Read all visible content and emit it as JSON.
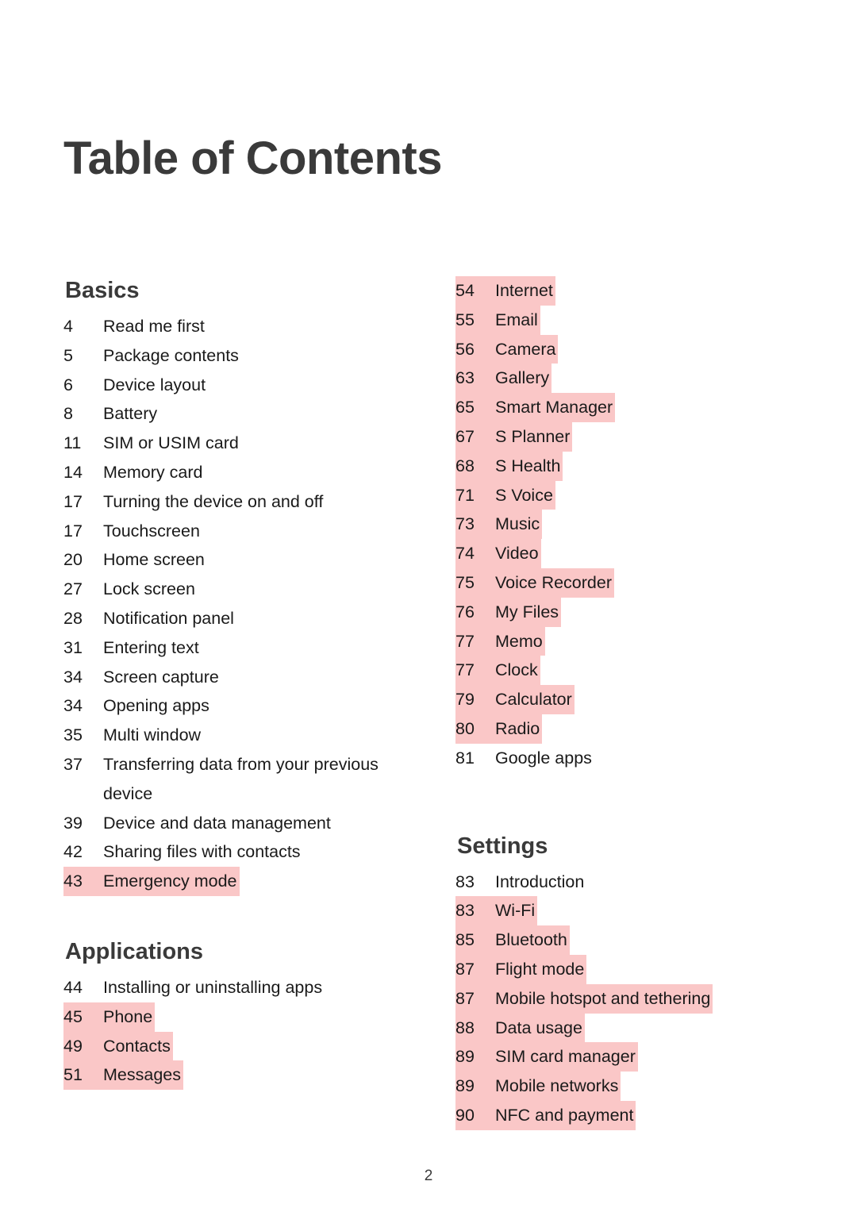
{
  "document": {
    "title": "Table of Contents",
    "page_number": "2",
    "highlight_color": "#fac7c7",
    "text_color": "#1a1a1a",
    "heading_color": "#3a3a3a",
    "background_color": "#ffffff"
  },
  "columns": {
    "left": {
      "sections": [
        {
          "heading": "Basics",
          "heading_highlighted": false,
          "entries": [
            {
              "page": "4",
              "label": "Read me first",
              "highlighted": false
            },
            {
              "page": "5",
              "label": "Package contents",
              "highlighted": false
            },
            {
              "page": "6",
              "label": "Device layout",
              "highlighted": false
            },
            {
              "page": "8",
              "label": "Battery",
              "highlighted": false
            },
            {
              "page": "11",
              "label": "SIM or USIM card",
              "highlighted": false
            },
            {
              "page": "14",
              "label": "Memory card",
              "highlighted": false
            },
            {
              "page": "17",
              "label": "Turning the device on and off",
              "highlighted": false
            },
            {
              "page": "17",
              "label": "Touchscreen",
              "highlighted": false
            },
            {
              "page": "20",
              "label": "Home screen",
              "highlighted": false
            },
            {
              "page": "27",
              "label": "Lock screen",
              "highlighted": false
            },
            {
              "page": "28",
              "label": "Notification panel",
              "highlighted": false
            },
            {
              "page": "31",
              "label": "Entering text",
              "highlighted": false
            },
            {
              "page": "34",
              "label": "Screen capture",
              "highlighted": false
            },
            {
              "page": "34",
              "label": "Opening apps",
              "highlighted": false
            },
            {
              "page": "35",
              "label": "Multi window",
              "highlighted": false
            },
            {
              "page": "37",
              "label": "Transferring data from your previous device",
              "highlighted": false
            },
            {
              "page": "39",
              "label": "Device and data management",
              "highlighted": false
            },
            {
              "page": "42",
              "label": "Sharing files with contacts",
              "highlighted": false
            },
            {
              "page": "43",
              "label": "Emergency mode",
              "highlighted": true
            }
          ]
        },
        {
          "heading": "Applications",
          "heading_highlighted": false,
          "entries": [
            {
              "page": "44",
              "label": "Installing or uninstalling apps",
              "highlighted": false
            },
            {
              "page": "45",
              "label": "Phone",
              "highlighted": true
            },
            {
              "page": "49",
              "label": "Contacts",
              "highlighted": true
            },
            {
              "page": "51",
              "label": "Messages",
              "highlighted": true
            }
          ]
        }
      ]
    },
    "right": {
      "sections": [
        {
          "heading": "",
          "heading_highlighted": false,
          "entries": [
            {
              "page": "54",
              "label": "Internet",
              "highlighted": true
            },
            {
              "page": "55",
              "label": "Email",
              "highlighted": true
            },
            {
              "page": "56",
              "label": "Camera",
              "highlighted": true
            },
            {
              "page": "63",
              "label": "Gallery",
              "highlighted": true
            },
            {
              "page": "65",
              "label": "Smart Manager",
              "highlighted": true
            },
            {
              "page": "67",
              "label": "S Planner",
              "highlighted": true
            },
            {
              "page": "68",
              "label": "S Health",
              "highlighted": true
            },
            {
              "page": "71",
              "label": "S Voice",
              "highlighted": true
            },
            {
              "page": "73",
              "label": "Music",
              "highlighted": true
            },
            {
              "page": "74",
              "label": "Video",
              "highlighted": true
            },
            {
              "page": "75",
              "label": "Voice Recorder",
              "highlighted": true
            },
            {
              "page": "76",
              "label": "My Files",
              "highlighted": true
            },
            {
              "page": "77",
              "label": "Memo",
              "highlighted": true
            },
            {
              "page": "77",
              "label": "Clock",
              "highlighted": true
            },
            {
              "page": "79",
              "label": "Calculator",
              "highlighted": true
            },
            {
              "page": "80",
              "label": "Radio",
              "highlighted": true
            },
            {
              "page": "81",
              "label": "Google apps",
              "highlighted": false
            }
          ]
        },
        {
          "heading": "Settings",
          "heading_highlighted": true,
          "entries": [
            {
              "page": "83",
              "label": "Introduction",
              "highlighted": false
            },
            {
              "page": "83",
              "label": "Wi-Fi",
              "highlighted": true
            },
            {
              "page": "85",
              "label": "Bluetooth",
              "highlighted": true
            },
            {
              "page": "87",
              "label": "Flight mode",
              "highlighted": true
            },
            {
              "page": "87",
              "label": "Mobile hotspot and tethering",
              "highlighted": true
            },
            {
              "page": "88",
              "label": "Data usage",
              "highlighted": true
            },
            {
              "page": "89",
              "label": "SIM card manager",
              "highlighted": true
            },
            {
              "page": "89",
              "label": "Mobile networks",
              "highlighted": true
            },
            {
              "page": "90",
              "label": "NFC and payment",
              "highlighted": true
            }
          ]
        }
      ]
    }
  }
}
